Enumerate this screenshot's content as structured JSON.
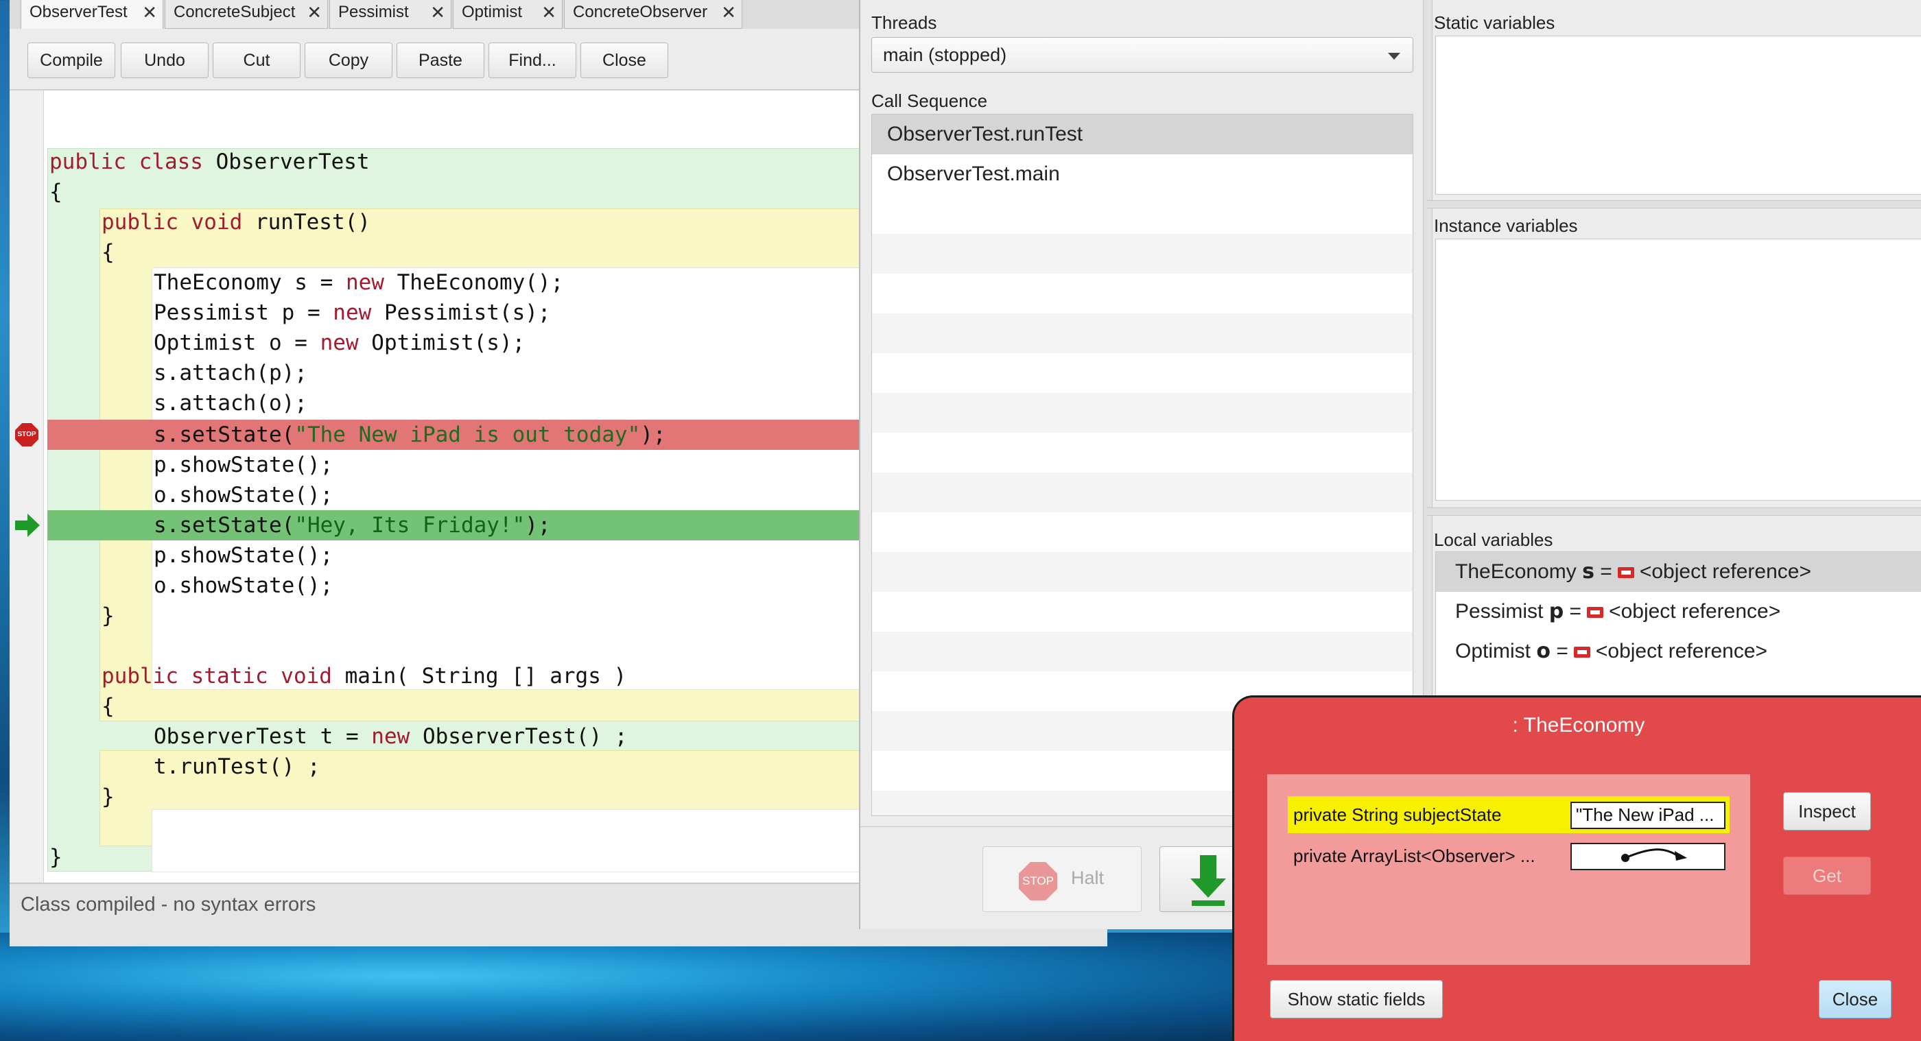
{
  "editor": {
    "tabs": [
      {
        "label": "ObserverTest"
      },
      {
        "label": "ConcreteSubject"
      },
      {
        "label": "Pessimist"
      },
      {
        "label": "Optimist"
      },
      {
        "label": "ConcreteObserver"
      }
    ],
    "toolbar": [
      "Compile",
      "Undo",
      "Cut",
      "Copy",
      "Paste",
      "Find...",
      "Close"
    ],
    "breakpoint_label": "STOP",
    "status": "Class compiled - no syntax errors"
  },
  "debugger": {
    "threads_label": "Threads",
    "thread_selected": "main (stopped)",
    "call_sequence_label": "Call Sequence",
    "call_sequence": [
      "ObserverTest.runTest",
      "ObserverTest.main"
    ],
    "static_variables_label": "Static variables",
    "instance_variables_label": "Instance variables",
    "local_variables_label": "Local variables",
    "local_variables": [
      {
        "type": "TheEconomy",
        "name": "s",
        "eq": "=",
        "value": "<object reference>"
      },
      {
        "type": "Pessimist",
        "name": "p",
        "eq": "=",
        "value": "<object reference>"
      },
      {
        "type": "Optimist",
        "name": "o",
        "eq": "=",
        "value": "<object reference>"
      }
    ],
    "halt_icon_text": "STOP",
    "halt_label": "Halt"
  },
  "inspector": {
    "title": ": TheEconomy",
    "fields": [
      {
        "label": "private String subjectState",
        "value": "\"The New iPad ..."
      },
      {
        "label": "private ArrayList<Observer> ...",
        "value": ""
      }
    ],
    "inspect_label": "Inspect",
    "get_label": "Get",
    "show_static_label": "Show static fields",
    "close_label": "Close"
  },
  "colors": {
    "breakpoint_line": "#e27575",
    "current_line": "#74c275",
    "inspector_bg": "#e2494b",
    "selected_field": "#f7f000"
  }
}
